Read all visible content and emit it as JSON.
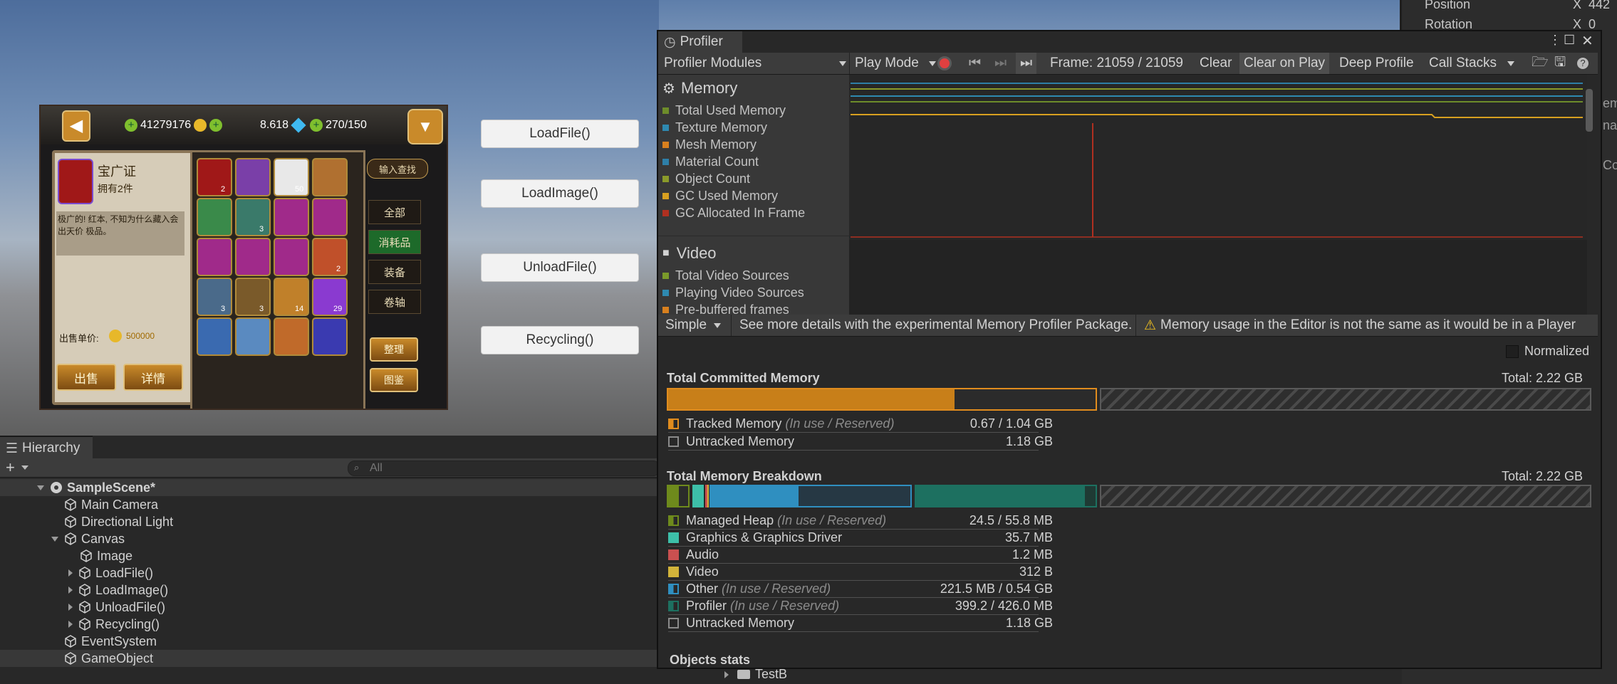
{
  "scene": {
    "buttons": [
      "LoadFile()",
      "LoadImage()",
      "UnloadFile()",
      "Recycling()"
    ],
    "game": {
      "gold": "41279176",
      "gems": "8.618",
      "stamina": "270/150",
      "item_title": "宝广证",
      "item_owned": "拥有2件",
      "item_desc": "极广的! 红本, 不知为什么藏入会出天价 极品。",
      "sell_price_label": "出售单价:",
      "sell_price_value": "500000",
      "sell_button": "出售",
      "detail_button": "详情",
      "search_button": "输入查找",
      "filters": [
        "全部",
        "消耗品",
        "装备",
        "卷轴"
      ],
      "bottom_buttons": [
        "整理",
        "图鉴"
      ],
      "item_counts": [
        "2",
        "50",
        "3",
        "2",
        "3",
        "3",
        "14",
        "29"
      ]
    }
  },
  "hierarchy": {
    "tab_label": "Hierarchy",
    "add_label": "+",
    "search_placeholder": "All",
    "items": [
      {
        "label": "SampleScene*"
      },
      {
        "label": "Main Camera"
      },
      {
        "label": "Directional Light"
      },
      {
        "label": "Canvas"
      },
      {
        "label": "Image"
      },
      {
        "label": "LoadFile()"
      },
      {
        "label": "LoadImage()"
      },
      {
        "label": "UnloadFile()"
      },
      {
        "label": "Recycling()"
      },
      {
        "label": "EventSystem"
      },
      {
        "label": "GameObject"
      }
    ],
    "project_row": "TestB"
  },
  "inspector": {
    "position_label": "Position",
    "rotation_label": "Rotation",
    "x_label": "X",
    "position_x": "442",
    "rotation_x": "0",
    "cut_text_1": "em",
    "cut_text_2": "nag",
    "cut_text_3": "Com"
  },
  "profiler": {
    "tab_label": "Profiler",
    "toolbar": {
      "modules": "Profiler Modules",
      "play_mode": "Play Mode",
      "frame": "Frame: 21059 / 21059",
      "clear": "Clear",
      "clear_on_play": "Clear on Play",
      "deep_profile": "Deep Profile",
      "call_stacks": "Call Stacks"
    },
    "memory_module": {
      "title": "Memory",
      "legend": [
        {
          "label": "Total Used Memory",
          "color": "#6d8c2a"
        },
        {
          "label": "Texture Memory",
          "color": "#2e89b0"
        },
        {
          "label": "Mesh Memory",
          "color": "#d8801e"
        },
        {
          "label": "Material Count",
          "color": "#2e7fa8"
        },
        {
          "label": "Object Count",
          "color": "#8a9a2a"
        },
        {
          "label": "GC Used Memory",
          "color": "#d8a020"
        },
        {
          "label": "GC Allocated In Frame",
          "color": "#b03020"
        }
      ]
    },
    "video_module": {
      "title": "Video",
      "legend": [
        {
          "label": "Total Video Sources",
          "color": "#7a9a2a"
        },
        {
          "label": "Playing Video Sources",
          "color": "#2e89b0"
        },
        {
          "label": "Pre-buffered frames",
          "color": "#d8801e"
        }
      ]
    },
    "subbar": {
      "view_mode": "Simple",
      "info": "See more details with the experimental Memory Profiler Package.",
      "warning": "Memory usage in the Editor is not the same as it would be in a Player"
    },
    "normalized_label": "Normalized",
    "committed": {
      "title": "Total Committed Memory",
      "total": "Total: 2.22 GB",
      "tracked_fraction": 0.67,
      "rows": [
        {
          "label": "Tracked Memory",
          "hint": "(In use / Reserved)",
          "value": "0.67 / 1.04 GB",
          "color": "#e08c1e"
        },
        {
          "label": "Untracked Memory",
          "hint": "",
          "value": "1.18 GB",
          "color": "none"
        }
      ]
    },
    "breakdown": {
      "title": "Total Memory Breakdown",
      "total": "Total: 2.22 GB",
      "rows": [
        {
          "label": "Managed Heap",
          "hint": "(In use / Reserved)",
          "value": "24.5 / 55.8 MB",
          "color": "#6e8a1c"
        },
        {
          "label": "Graphics & Graphics Driver",
          "hint": "",
          "value": "35.7 MB",
          "color": "#3dbfa9"
        },
        {
          "label": "Audio",
          "hint": "",
          "value": "1.2 MB",
          "color": "#c95050"
        },
        {
          "label": "Video",
          "hint": "",
          "value": "312 B",
          "color": "#d2b33a"
        },
        {
          "label": "Other",
          "hint": "(In use / Reserved)",
          "value": "221.5 MB / 0.54 GB",
          "color": "#2f8fc0"
        },
        {
          "label": "Profiler",
          "hint": "(In use / Reserved)",
          "value": "399.2 / 426.0 MB",
          "color": "#1d7060"
        },
        {
          "label": "Untracked Memory",
          "hint": "",
          "value": "1.18 GB",
          "color": "none"
        }
      ]
    },
    "objects_stats": "Objects stats"
  }
}
